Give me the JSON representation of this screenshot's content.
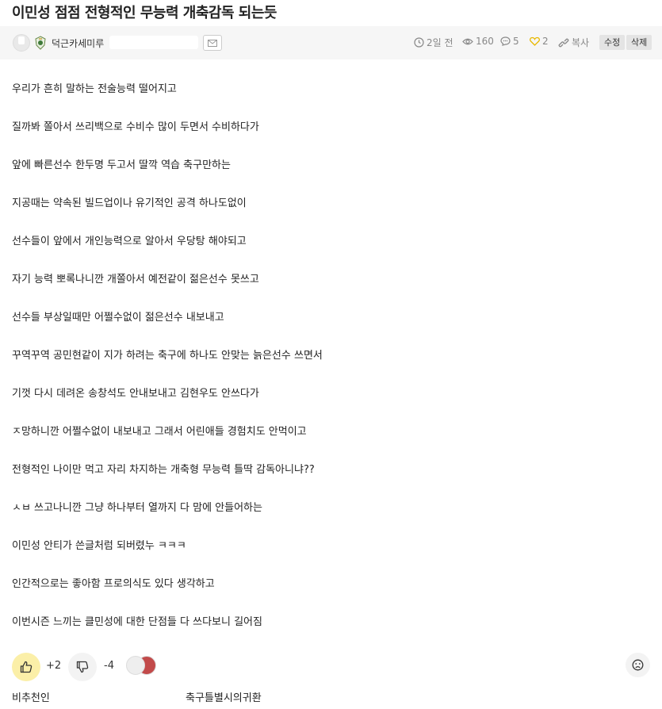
{
  "post": {
    "title": "이민성 점점 전형적인 무능력 개축감독 되는듯",
    "author": "덕근카세미루",
    "time": "2일 전",
    "views": "160",
    "comments": "5",
    "likes": "2",
    "copy_label": "복사",
    "edit_label": "수정",
    "delete_label": "삭제"
  },
  "body_lines": [
    "우리가 흔히 말하는 전술능력 떨어지고",
    "질까봐 쫄아서 쓰리백으로 수비수 많이 두면서 수비하다가",
    "앞에 빠른선수 한두명 두고서 딸깍 역습 축구만하는",
    "지공때는 약속된 빌드업이나 유기적인 공격 하나도없이",
    "선수들이 앞에서 개인능력으로 알아서 우당탕 해야되고",
    "자기 능력 뽀록나니깐 개쫄아서 예전같이 젊은선수 못쓰고",
    "선수들 부상일때만 어쩔수없이 젊은선수 내보내고",
    "꾸역꾸역 공민현같이 지가 하려는 축구에 하나도 안맞는 늙은선수 쓰면서",
    "기껏 다시 데려온 송창석도 안내보내고 김현우도 안쓰다가",
    "ㅈ망하니깐 어쩔수없이 내보내고 그래서 어린애들 경험치도 안먹이고",
    "전형적인 나이만 먹고 자리 차지하는 개축형 무능력 틀딱 감독아니냐??",
    "ㅅㅂ 쓰고나니깐 그냥 하나부터 열까지 다 맘에 안들어하는",
    "이민성 안티가 쓴글처럼 되버렸누 ㅋㅋㅋ",
    "인간적으로는 좋아함 프로의식도 있다 생각하고",
    "이번시즌 느끼는 클민성에 대한 단점들 다 쓰다보니 길어짐"
  ],
  "votes": {
    "up": "+2",
    "down": "-4"
  },
  "voters": [
    "비추천인",
    "축구틀별시의귀환"
  ],
  "icons": {
    "clock": "clock-icon",
    "views": "eye-icon",
    "comments": "comment-icon",
    "likes": "heart-icon",
    "copy": "link-icon",
    "message": "envelope-icon",
    "thumbs_up": "thumbs-up-icon",
    "thumbs_down": "thumbs-down-icon",
    "report": "sad-face-icon"
  },
  "colors": {
    "heart": "#e8b800",
    "vote_up_bg": "#fbefa8"
  }
}
